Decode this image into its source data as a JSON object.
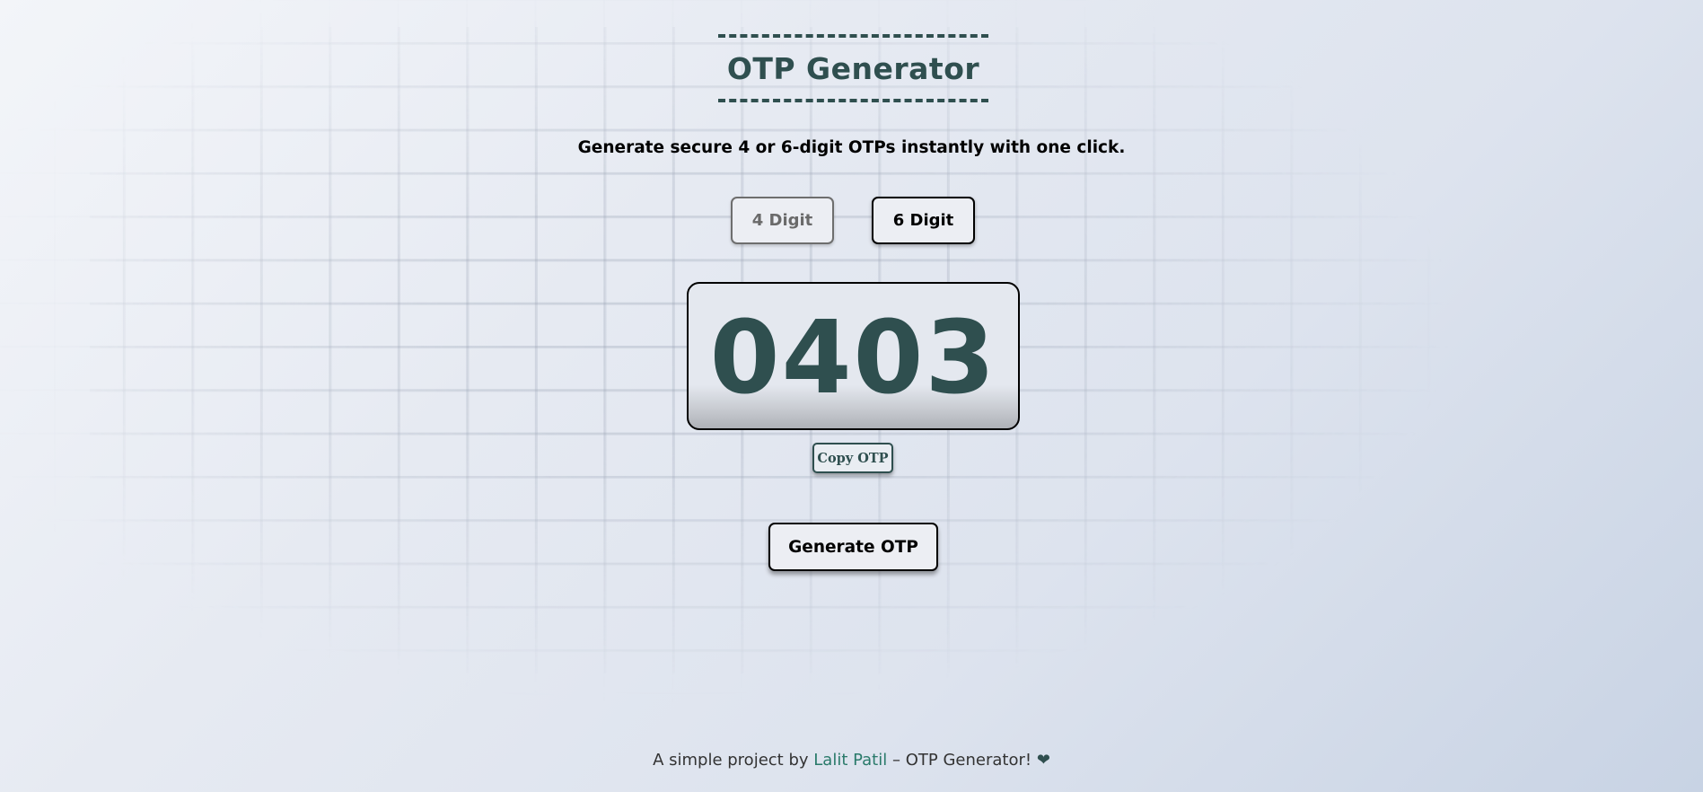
{
  "header": {
    "title": "OTP Generator",
    "subtitle": "Generate secure 4 or 6-digit OTPs instantly with one click."
  },
  "digit_options": {
    "four_label": "4 Digit",
    "six_label": "6 Digit",
    "selected": "4 Digit"
  },
  "otp": {
    "value": "0403",
    "copy_label": "Copy OTP"
  },
  "actions": {
    "generate_label": "Generate OTP"
  },
  "footer": {
    "prefix": "A simple project by",
    "author": "Lalit Patil",
    "suffix": "– OTP Generator!",
    "heart_icon": "heart-icon",
    "heart_glyph": "❤"
  },
  "colors": {
    "accent": "#2f4f4f",
    "link": "#2a7a6a"
  }
}
